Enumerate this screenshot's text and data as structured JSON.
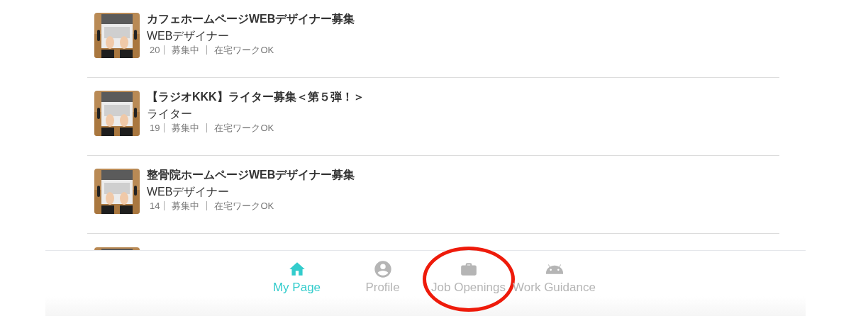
{
  "jobs": [
    {
      "title": "カフェホームページWEBデザイナー募集",
      "role": "WEBデザイナー",
      "count": "20",
      "status": "募集中",
      "remote": "在宅ワークOK"
    },
    {
      "title": "【ラジオKKK】ライター募集＜第５弾！＞",
      "role": "ライター",
      "count": "19",
      "status": "募集中",
      "remote": "在宅ワークOK"
    },
    {
      "title": "整骨院ホームページWEBデザイナー募集",
      "role": "WEBデザイナー",
      "count": "14",
      "status": "募集中",
      "remote": "在宅ワークOK"
    }
  ],
  "bottom_nav": [
    {
      "kind": "home",
      "label": "My Page",
      "selected": true,
      "circled": false
    },
    {
      "kind": "profile",
      "label": "Profile",
      "selected": false,
      "circled": false
    },
    {
      "kind": "briefcase",
      "label": "Job Openings",
      "selected": false,
      "circled": true
    },
    {
      "kind": "android",
      "label": "Work Guidance",
      "selected": false,
      "circled": false
    }
  ]
}
